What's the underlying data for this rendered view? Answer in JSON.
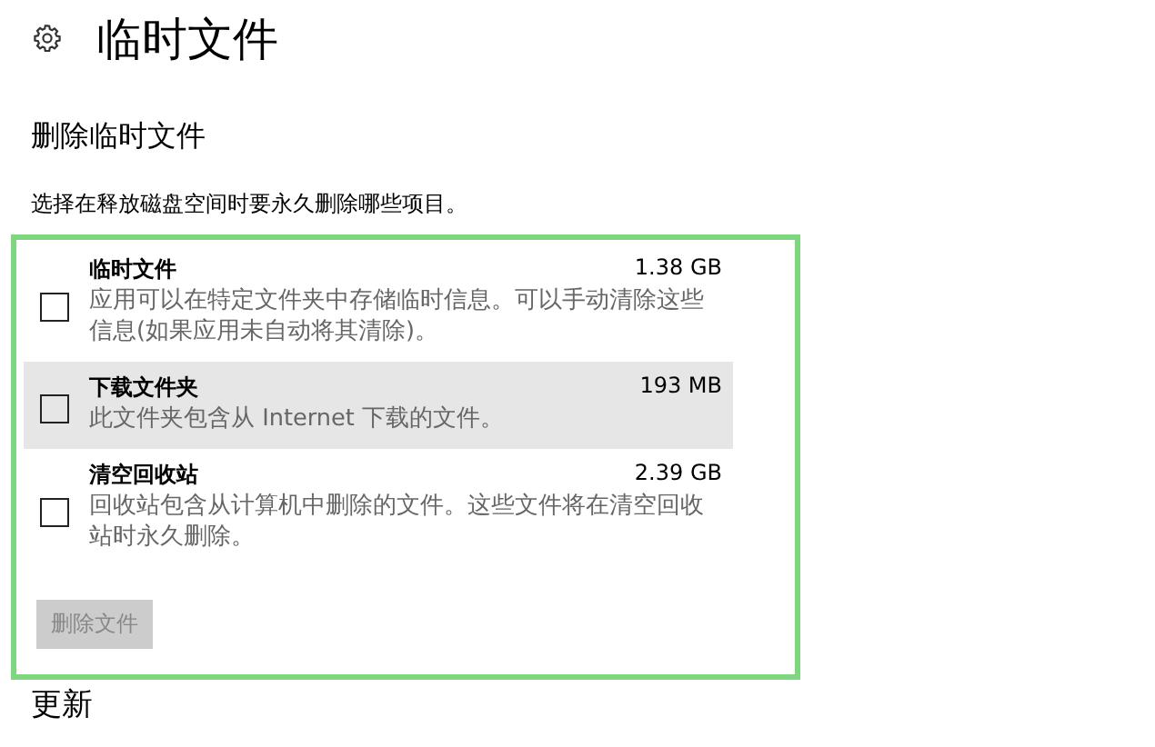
{
  "title": "临时文件",
  "section": {
    "heading": "删除临时文件",
    "description": "选择在释放磁盘空间时要永久删除哪些项目。"
  },
  "items": [
    {
      "name": "临时文件",
      "size": "1.38 GB",
      "description": "应用可以在特定文件夹中存储临时信息。可以手动清除这些信息(如果应用未自动将其清除)。",
      "checked": false,
      "highlighted": false
    },
    {
      "name": "下载文件夹",
      "size": "193 MB",
      "description": "此文件夹包含从 Internet 下载的文件。",
      "checked": false,
      "highlighted": true
    },
    {
      "name": "清空回收站",
      "size": "2.39 GB",
      "description": "回收站包含从计算机中删除的文件。这些文件将在清空回收站时永久删除。",
      "checked": false,
      "highlighted": false
    }
  ],
  "delete_button": {
    "label": "删除文件",
    "disabled": true
  },
  "next_heading": "更新"
}
